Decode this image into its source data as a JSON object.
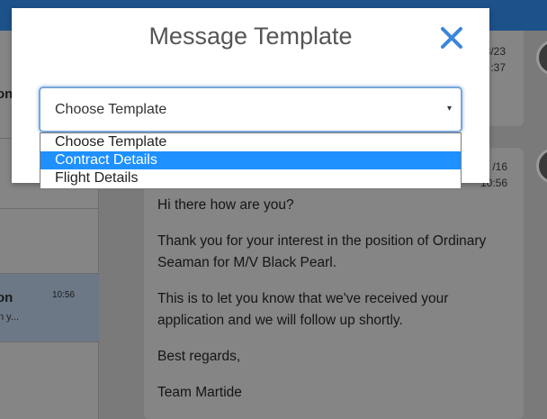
{
  "background": {
    "conversations": [
      {
        "name": "on"
      },
      {
        "name": "on",
        "time": "10:56",
        "snippet": "n y..."
      }
    ],
    "top_message": {
      "date": "3/23",
      "time": ":37"
    },
    "message": {
      "date": "/16",
      "time": "10:56",
      "paragraphs": [
        "Hi there how are you?",
        "Thank you for your interest in the position of Ordinary Seaman for M/V Black Pearl.",
        "This is to let you know that we've received your application and we will follow up shortly.",
        "Best regards,",
        "Team Martide"
      ]
    }
  },
  "modal": {
    "title": "Message Template",
    "close_icon": "close-icon",
    "select": {
      "value": "Choose Template",
      "caret": "▾"
    },
    "options": [
      {
        "label": "Choose Template",
        "highlighted": false
      },
      {
        "label": "Contract Details",
        "highlighted": true
      },
      {
        "label": "Flight Details",
        "highlighted": false
      }
    ]
  },
  "colors": {
    "accent": "#1e90ff",
    "close_icon": "#3a86d9",
    "header": "#1c5289"
  }
}
